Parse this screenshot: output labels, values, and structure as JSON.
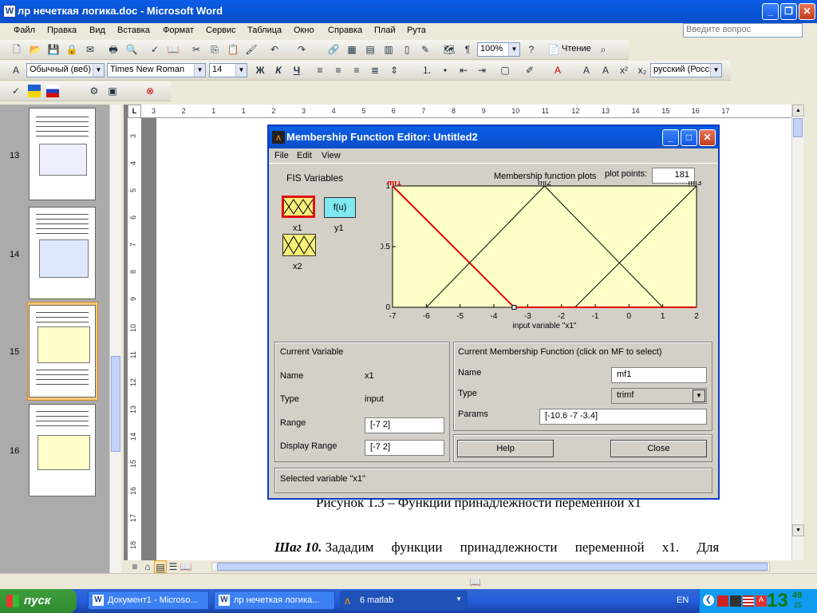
{
  "window": {
    "title": "лр нечеткая логика.doc - Microsoft Word",
    "icon": "word-icon"
  },
  "menu": [
    "Файл",
    "Правка",
    "Вид",
    "Вставка",
    "Формат",
    "Сервис",
    "Таблица",
    "Окно",
    "Справка",
    "Плай",
    "Рута"
  ],
  "ask_placeholder": "Введите вопрос",
  "toolbar": {
    "zoom": "100%",
    "read_label": "Чтение",
    "style": "Обычный (веб)",
    "font": "Times New Roman",
    "size": "14",
    "bold": "Ж",
    "italic": "К",
    "underline": "Ч",
    "language": "русский (Росси"
  },
  "thumbnails": [
    {
      "num": "13"
    },
    {
      "num": "14"
    },
    {
      "num": "15"
    },
    {
      "num": "16"
    }
  ],
  "ruler_numbers": [
    "3",
    "2",
    "1",
    "1",
    "2",
    "3",
    "4",
    "5",
    "6",
    "7",
    "8",
    "9",
    "10",
    "11",
    "12",
    "13",
    "14",
    "15",
    "16",
    "17"
  ],
  "vruler_numbers": [
    "3",
    "4",
    "5",
    "6",
    "7",
    "8",
    "9",
    "10",
    "11",
    "12",
    "13",
    "14",
    "15",
    "16",
    "17",
    "18"
  ],
  "doc_text": {
    "caption": "Рисунок 1.3 – Функции принадлежности переменной x1",
    "step_label": "Шаг 10.",
    "step_text": "Зададим функции принадлежности переменной x1. Для"
  },
  "mf_editor": {
    "title": "Membership Function Editor: Untitled2",
    "menu": [
      "File",
      "Edit",
      "View"
    ],
    "fis_label": "FIS Variables",
    "vars": {
      "x1": "x1",
      "y1": "y1",
      "x2": "x2",
      "func": "f(u)"
    },
    "plots_label": "Membership function plots",
    "plot_points_label": "plot points:",
    "plot_points": "181",
    "axis_label": "input variable \"x1\"",
    "current_variable": {
      "header": "Current Variable",
      "name_label": "Name",
      "name": "x1",
      "type_label": "Type",
      "type": "input",
      "range_label": "Range",
      "range": "[-7 2]",
      "display_range_label": "Display Range",
      "display_range": "[-7 2]"
    },
    "current_mf": {
      "header": "Current Membership Function (click on MF to select)",
      "name_label": "Name",
      "name": "mf1",
      "type_label": "Type",
      "type": "trimf",
      "params_label": "Params",
      "params": "[-10.6 -7 -3.4]"
    },
    "help": "Help",
    "close": "Close",
    "status": "Selected variable \"x1\""
  },
  "chart_data": {
    "type": "line",
    "xlim": [
      -7,
      2
    ],
    "ylim": [
      0,
      1
    ],
    "xticks": [
      "-7",
      "-6",
      "-5",
      "-4",
      "-3",
      "-2",
      "-1",
      "0",
      "1",
      "2"
    ],
    "yticks": [
      "0",
      "0.5",
      "1"
    ],
    "xlabel": "input variable \"x1\"",
    "series": [
      {
        "name": "mf1",
        "x": [
          -7,
          -3.4
        ],
        "y": [
          1,
          0
        ],
        "selected": true
      },
      {
        "name": "mf2",
        "x": [
          -6,
          -2.5,
          1
        ],
        "y": [
          0,
          1,
          0
        ]
      },
      {
        "name": "mf3",
        "x": [
          -1.6,
          2
        ],
        "y": [
          0,
          1
        ]
      }
    ],
    "colors": {
      "selected": "#e00000",
      "normal": "#000000",
      "background": "#ffffc8"
    }
  },
  "taskbar": {
    "start": "пуск",
    "tasks": [
      "Документ1 - Microso...",
      "лр нечеткая логика...",
      "6 matlab"
    ],
    "lang": "EN",
    "time": "13",
    "time_min": "49",
    "time_sec": "25"
  }
}
